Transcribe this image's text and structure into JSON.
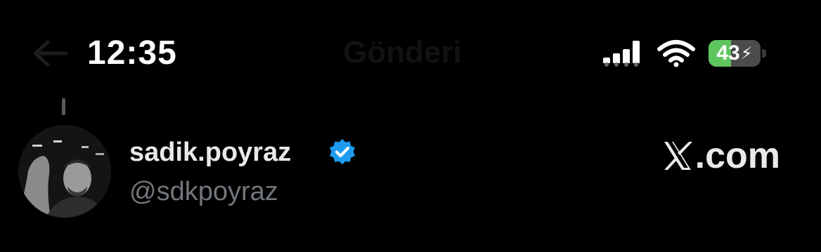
{
  "status_bar": {
    "time": "12:35",
    "battery_percent": "43",
    "battery_level": 0.43,
    "battery_charging": true,
    "battery_fill_color": "#5ec55f",
    "signal_bars_filled": 3,
    "signal_bars_total": 4
  },
  "header": {
    "back_icon": "arrow-left-icon",
    "title": "Gönderi"
  },
  "post": {
    "display_name": "sadik.poyraz",
    "handle": "@sdkpoyraz",
    "verified": true,
    "verified_color": "#1d9bf0",
    "avatar": "profile-photo"
  },
  "brand": {
    "x_logo": "x-logo-icon",
    "domain_text": ".com"
  }
}
